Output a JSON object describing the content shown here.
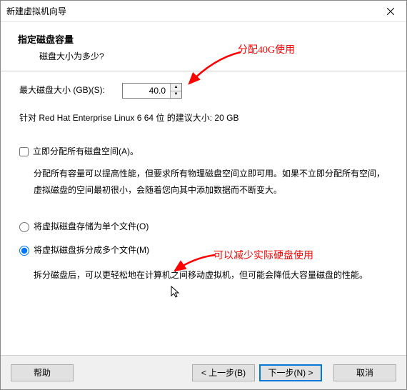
{
  "titlebar": {
    "title": "新建虚拟机向导"
  },
  "header": {
    "title": "指定磁盘容量",
    "subtitle": "磁盘大小为多少?"
  },
  "size": {
    "label": "最大磁盘大小 (GB)(S):",
    "value": "40.0"
  },
  "recommend": "针对 Red Hat Enterprise Linux 6 64 位 的建议大小: 20 GB",
  "checkbox": {
    "label": "立即分配所有磁盘空间(A)。",
    "explain": "分配所有容量可以提高性能，但要求所有物理磁盘空间立即可用。如果不立即分配所有空间，虚拟磁盘的空间最初很小，会随着您向其中添加数据而不断变大。"
  },
  "radio": {
    "single": "将虚拟磁盘存储为单个文件(O)",
    "split": "将虚拟磁盘拆分成多个文件(M)",
    "split_explain": "拆分磁盘后，可以更轻松地在计算机之间移动虚拟机，但可能会降低大容量磁盘的性能。"
  },
  "annotations": {
    "a1": "分配40G使用",
    "a2": "可以减少实际硬盘使用"
  },
  "footer": {
    "help": "帮助",
    "back": "< 上一步(B)",
    "next": "下一步(N) >",
    "cancel": "取消"
  }
}
